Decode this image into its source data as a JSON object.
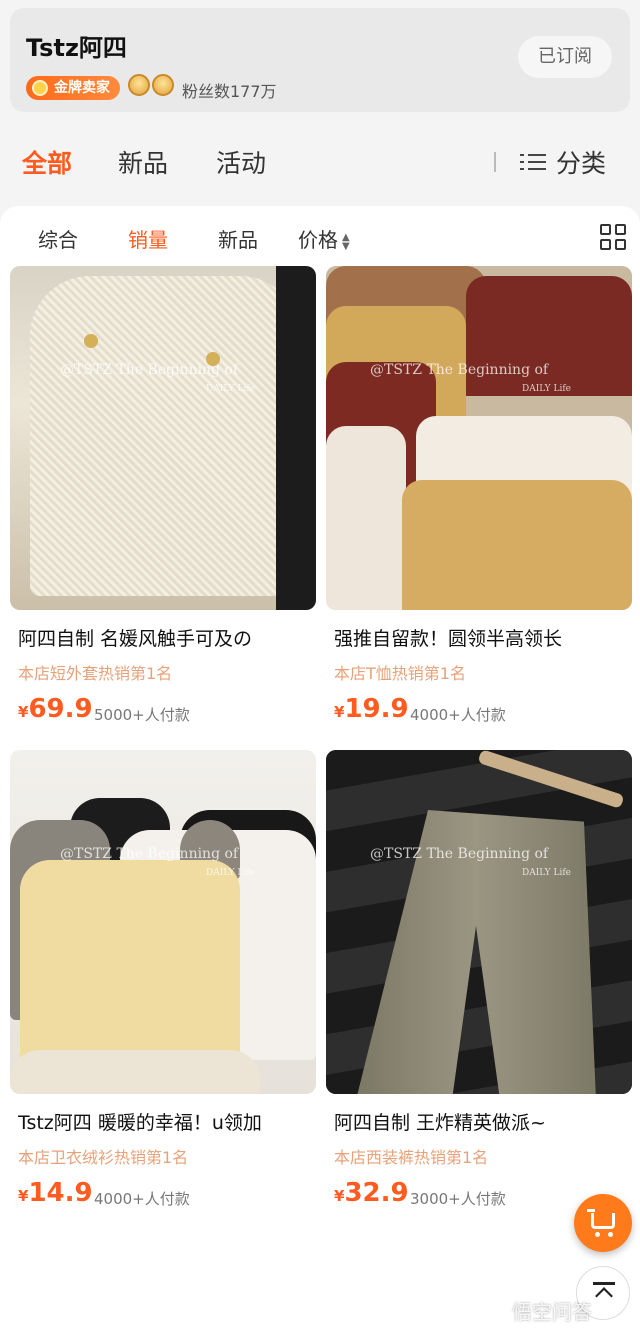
{
  "store": {
    "name": "Tstz阿四",
    "badge": "金牌卖家",
    "fans": "粉丝数177万",
    "subscribe_label": "已订阅"
  },
  "main_tabs": [
    "全部",
    "新品",
    "活动"
  ],
  "category_label": "分类",
  "sort_options": [
    "综合",
    "销量",
    "新品",
    "价格"
  ],
  "active_sort": "销量",
  "products": [
    {
      "title": "阿四自制 名媛风触手可及の",
      "rank": "本店短外套热销第1名",
      "currency": "¥",
      "price": "69.9",
      "sold": "5000+人付款"
    },
    {
      "title": "强推自留款！圆领半高领长",
      "rank": "本店T恤热销第1名",
      "currency": "¥",
      "price": "19.9",
      "sold": "4000+人付款"
    },
    {
      "title": "Tstz阿四 暖暖的幸福！u领加",
      "rank": "本店卫衣绒衫热销第1名",
      "currency": "¥",
      "price": "14.9",
      "sold": "4000+人付款"
    },
    {
      "title": "阿四自制 王炸精英做派~",
      "rank": "本店西装裤热销第1名",
      "currency": "¥",
      "price": "32.9",
      "sold": "3000+人付款"
    }
  ],
  "photo_watermark": {
    "line1": "@TSTZ  The  Beginning of",
    "line2": "DAILY Life"
  },
  "site_watermark": "悟空问答",
  "colors": {
    "accent": "#ff5a1f",
    "rank_text": "#e8a27a",
    "fab": "#ff7a1a"
  }
}
